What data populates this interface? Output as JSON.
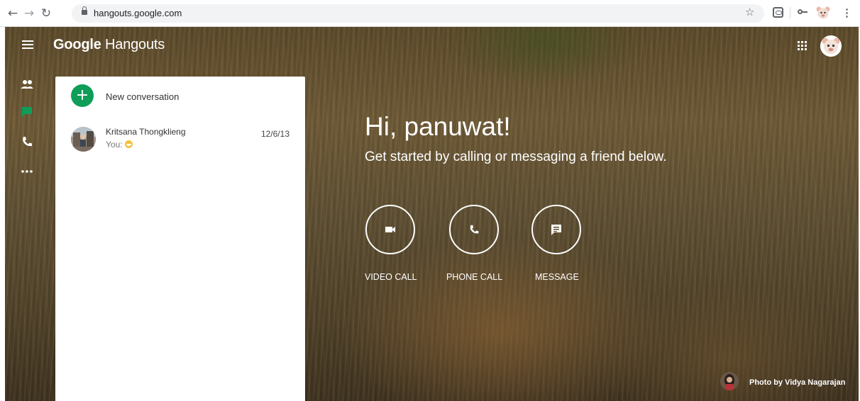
{
  "browser": {
    "url": "hangouts.google.com",
    "icons": [
      "back-arrow-icon",
      "forward-arrow-icon",
      "reload-icon",
      "lock-icon",
      "star-icon",
      "extension-icon",
      "key-icon",
      "profile-icon",
      "kebab-menu-icon"
    ]
  },
  "app": {
    "title_brand": "Google",
    "title_product": "Hangouts",
    "accent_color": "#0f9d58",
    "rail": [
      "contacts-icon",
      "chat-icon",
      "phone-icon",
      "more-icon"
    ]
  },
  "panel": {
    "new_conversation": "New conversation",
    "conversations": [
      {
        "name": "Kritsana Thongklieng",
        "preview": "You:",
        "date": "12/6/13"
      }
    ]
  },
  "welcome": {
    "greeting": "Hi, panuwat!",
    "subtitle": "Get started by calling or messaging a friend below.",
    "actions": [
      {
        "label": "VIDEO CALL",
        "icon": "video-camera-icon"
      },
      {
        "label": "PHONE CALL",
        "icon": "phone-icon"
      },
      {
        "label": "MESSAGE",
        "icon": "message-icon"
      }
    ]
  },
  "photo_credit": "Photo by Vidya Nagarajan"
}
